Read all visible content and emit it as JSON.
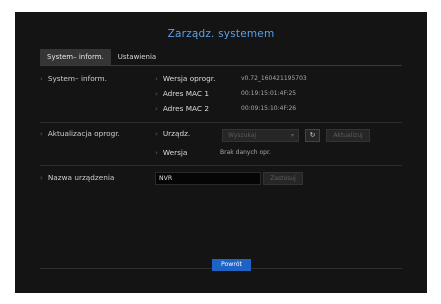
{
  "window": {
    "title": "Zarządz. systemem"
  },
  "tabs": [
    {
      "label": "System– inform.",
      "active": true
    },
    {
      "label": "Ustawienia",
      "active": false
    }
  ],
  "system_info": {
    "section_label": "System– inform.",
    "fields": [
      {
        "label": "Wersja oprogr.",
        "value": "v0.72_160421195703"
      },
      {
        "label": "Adres MAC 1",
        "value": "00:19:15:01:4F:25"
      },
      {
        "label": "Adres MAC 2",
        "value": "00:09:15:10:4F:26"
      }
    ]
  },
  "update": {
    "section_label": "Aktualizacja oprogr.",
    "device_label": "Urządz.",
    "device_select_value": "Wyszukaj",
    "refresh_icon": "refresh-icon",
    "update_button": "Aktualizuj",
    "version_label": "Wersja",
    "version_value": "Brak danych opr."
  },
  "device_name": {
    "section_label": "Nazwa urządzenia",
    "input_value": "NVR",
    "apply_button": "Zastosuj"
  },
  "footer": {
    "back_button": "Powrót"
  },
  "colors": {
    "background": "#141414",
    "title": "#5aa0e8",
    "primary_button": "#1f62c6",
    "active_tab": "#353535"
  }
}
